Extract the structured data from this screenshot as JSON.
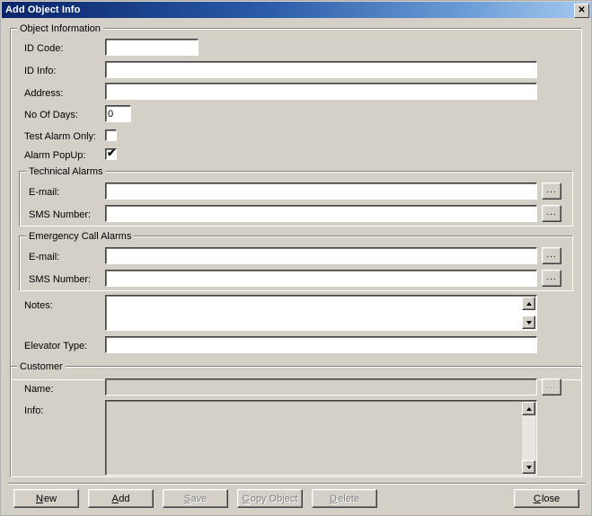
{
  "window": {
    "title": "Add Object Info",
    "close_icon": "close-icon",
    "close_glyph": "✕"
  },
  "object_information": {
    "legend": "Object Information",
    "id_code": {
      "label": "ID Code:",
      "value": ""
    },
    "id_info": {
      "label": "ID Info:",
      "value": ""
    },
    "address": {
      "label": "Address:",
      "value": ""
    },
    "no_of_days": {
      "label": "No Of Days:",
      "value": "0"
    },
    "test_alarm_only": {
      "label": "Test Alarm Only:",
      "checked": false
    },
    "alarm_popup": {
      "label": "Alarm PopUp:",
      "checked": true,
      "check_glyph": "✔"
    },
    "notes": {
      "label": "Notes:",
      "value": ""
    },
    "elevator_type": {
      "label": "Elevator Type:",
      "value": ""
    }
  },
  "technical_alarms": {
    "legend": "Technical Alarms",
    "email": {
      "label": "E-mail:",
      "value": ""
    },
    "sms_number": {
      "label": "SMS Number:",
      "value": ""
    },
    "browse_label": "..."
  },
  "emergency_call_alarms": {
    "legend": "Emergency Call Alarms",
    "email": {
      "label": "E-mail:",
      "value": ""
    },
    "sms_number": {
      "label": "SMS Number:",
      "value": ""
    },
    "browse_label": "..."
  },
  "customer": {
    "legend": "Customer",
    "name": {
      "label": "Name:",
      "value": ""
    },
    "info": {
      "label": "Info:",
      "value": ""
    },
    "browse_label": "..."
  },
  "buttons": {
    "new": {
      "label": "New",
      "accel": "N",
      "enabled": true
    },
    "add": {
      "label": "Add",
      "accel": "A",
      "enabled": true
    },
    "save": {
      "label": "Save",
      "accel": "S",
      "enabled": false
    },
    "copy_object": {
      "label": "Copy Object",
      "accel": "C",
      "enabled": false
    },
    "delete": {
      "label": "Delete",
      "accel": "D",
      "enabled": false
    },
    "close": {
      "label": "Close",
      "accel": "C",
      "enabled": true
    }
  },
  "colors": {
    "face": "#d4d0c8",
    "title_start": "#0a246a",
    "title_end": "#a6caf0",
    "field_bg": "#ffffff",
    "disabled_text": "#808080"
  }
}
